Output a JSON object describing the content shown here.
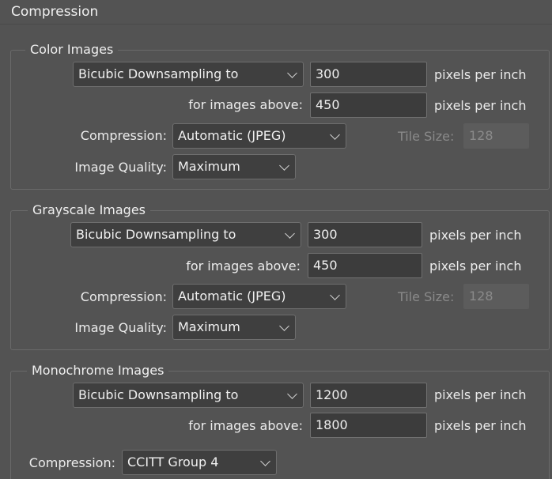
{
  "page_title": "Compression",
  "color": {
    "title": "Color Images",
    "downsampling": "Bicubic Downsampling to",
    "resolution": "300",
    "resolution_unit": "pixels per inch",
    "above_label": "for images above:",
    "above_value": "450",
    "above_unit": "pixels per inch",
    "compression_label": "Compression:",
    "compression": "Automatic (JPEG)",
    "tile_label": "Tile Size:",
    "tile_value": "128",
    "quality_label": "Image Quality:",
    "quality": "Maximum"
  },
  "grayscale": {
    "title": "Grayscale Images",
    "downsampling": "Bicubic Downsampling to",
    "resolution": "300",
    "resolution_unit": "pixels per inch",
    "above_label": "for images above:",
    "above_value": "450",
    "above_unit": "pixels per inch",
    "compression_label": "Compression:",
    "compression": "Automatic (JPEG)",
    "tile_label": "Tile Size:",
    "tile_value": "128",
    "quality_label": "Image Quality:",
    "quality": "Maximum"
  },
  "monochrome": {
    "title": "Monochrome Images",
    "downsampling": "Bicubic Downsampling to",
    "resolution": "1200",
    "resolution_unit": "pixels per inch",
    "above_label": "for images above:",
    "above_value": "1800",
    "above_unit": "pixels per inch",
    "compression_label": "Compression:",
    "compression": "CCITT Group 4"
  },
  "colors": {
    "background": "#535353",
    "field": "#3f3f3f",
    "border": "#6e6e6e",
    "text": "#ececec",
    "disabled_text": "#8a8a8a"
  },
  "icons": [
    "chevron-down-icon"
  ]
}
